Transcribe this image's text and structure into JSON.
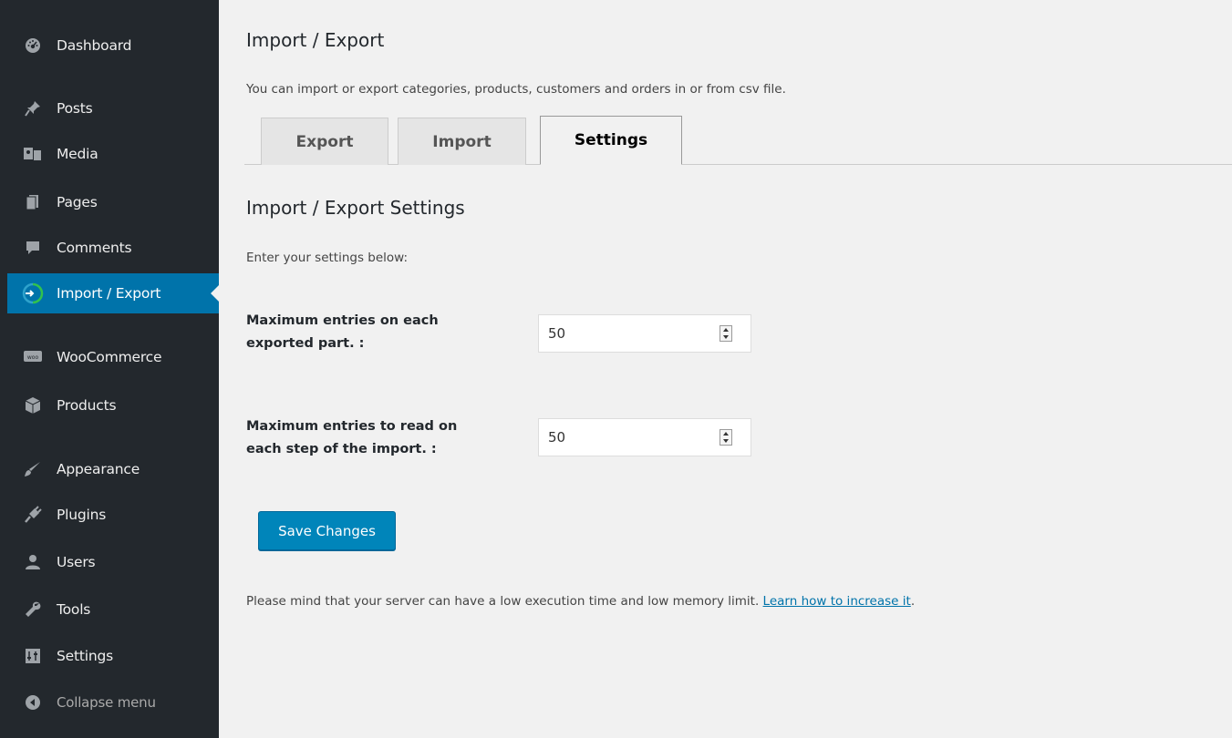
{
  "sidebar": {
    "items": [
      {
        "label": "Dashboard",
        "icon": "dashboard-icon"
      },
      {
        "label": "Posts",
        "icon": "pin-icon"
      },
      {
        "label": "Media",
        "icon": "media-icon"
      },
      {
        "label": "Pages",
        "icon": "pages-icon"
      },
      {
        "label": "Comments",
        "icon": "comment-icon"
      },
      {
        "label": "Import / Export",
        "icon": "import-export-icon",
        "current": true
      },
      {
        "label": "WooCommerce",
        "icon": "woo-icon"
      },
      {
        "label": "Products",
        "icon": "box-icon"
      },
      {
        "label": "Appearance",
        "icon": "brush-icon"
      },
      {
        "label": "Plugins",
        "icon": "plugin-icon"
      },
      {
        "label": "Users",
        "icon": "user-icon"
      },
      {
        "label": "Tools",
        "icon": "wrench-icon"
      },
      {
        "label": "Settings",
        "icon": "settings-icon"
      },
      {
        "label": "Collapse menu",
        "icon": "collapse-icon"
      }
    ]
  },
  "main": {
    "title": "Import / Export",
    "intro": "You can import or export categories, products, customers and orders in or from csv file.",
    "tabs": [
      {
        "label": "Export"
      },
      {
        "label": "Import"
      },
      {
        "label": "Settings",
        "active": true
      }
    ],
    "section_title": "Import / Export Settings",
    "section_desc": "Enter your settings below:",
    "fields": [
      {
        "label": "Maximum entries on each exported part. :",
        "value": "50"
      },
      {
        "label": "Maximum entries to read on each step of the import. :",
        "value": "50"
      }
    ],
    "save_label": "Save Changes",
    "note_text": "Please mind that your server can have a low execution time and low memory limit. ",
    "note_link": "Learn how to increase it",
    "note_end": "."
  },
  "colors": {
    "sidebar_bg": "#23282d",
    "accent": "#0073aa",
    "button": "#0085ba",
    "page_bg": "#f1f1f1"
  }
}
